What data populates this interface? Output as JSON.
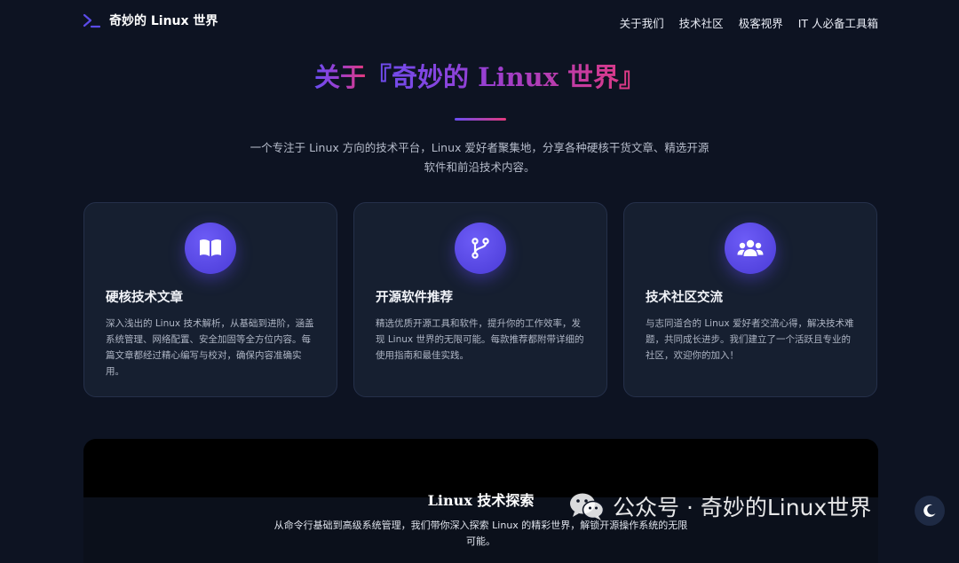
{
  "nav": {
    "brand": "奇妙的 Linux 世界",
    "items": [
      "关于我们",
      "技术社区",
      "极客视界",
      "IT 人必备工具箱"
    ]
  },
  "hero": {
    "title_prefix": "关于",
    "title_highlight": "『奇妙的 Linux 世界』",
    "description": "一个专注于 Linux 方向的技术平台，Linux 爱好者聚集地，分享各种硬核干货文章、精选开源软件和前沿技术内容。"
  },
  "cards": [
    {
      "icon": "book-icon",
      "title": "硬核技术文章",
      "text": "深入浅出的 Linux 技术解析，从基础到进阶，涵盖系统管理、网络配置、安全加固等全方位内容。每篇文章都经过精心编写与校对，确保内容准确实用。"
    },
    {
      "icon": "code-branch-icon",
      "title": "开源软件推荐",
      "text": "精选优质开源工具和软件，提升你的工作效率，发现 Linux 世界的无限可能。每款推荐都附带详细的使用指南和最佳实践。"
    },
    {
      "icon": "users-icon",
      "title": "技术社区交流",
      "text": "与志同道合的 Linux 爱好者交流心得，解决技术难题，共同成长进步。我们建立了一个活跃且专业的社区，欢迎你的加入！"
    }
  ],
  "panel": {
    "title": "Linux 技术探索",
    "description": "从命令行基础到高级系统管理，我们带你深入探索 Linux 的精彩世界，解锁开源操作系统的无限可能。"
  },
  "watermark": "公众号 · 奇妙的Linux世界",
  "colors": {
    "accent": "#5b4be8",
    "pink": "#e4397c",
    "background": "#0d1322",
    "card": "#161f30"
  }
}
